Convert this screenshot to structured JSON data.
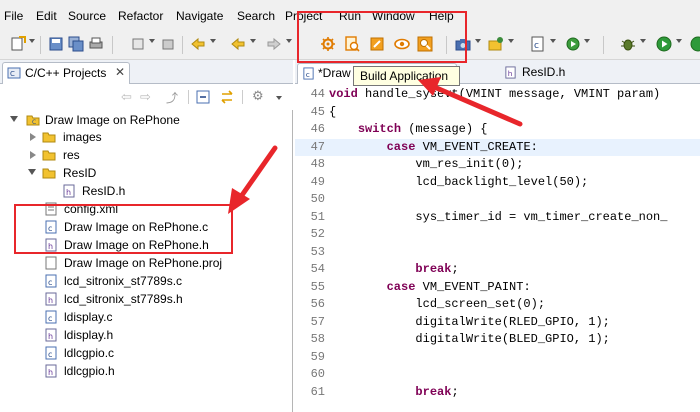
{
  "menu": [
    "File",
    "Edit",
    "Source",
    "Refactor",
    "Navigate",
    "Search",
    "Project",
    "Run",
    "Window",
    "Help"
  ],
  "tooltip": "Build Application",
  "project_panel": {
    "tab_label": "C/C++ Projects",
    "tree": [
      {
        "label": "Draw Image on RePhone",
        "kind": "project",
        "twisty": "open"
      },
      {
        "label": "images",
        "kind": "folder",
        "twisty": "closed"
      },
      {
        "label": "res",
        "kind": "folder",
        "twisty": "closed"
      },
      {
        "label": "ResID",
        "kind": "folder",
        "twisty": "open"
      },
      {
        "label": "ResID.h",
        "kind": "header"
      },
      {
        "label": "config.xml",
        "kind": "xml"
      },
      {
        "label": "Draw Image on RePhone.c",
        "kind": "c-source"
      },
      {
        "label": "Draw Image on RePhone.h",
        "kind": "header"
      },
      {
        "label": "Draw Image on RePhone.proj",
        "kind": "file"
      },
      {
        "label": "lcd_sitronix_st7789s.c",
        "kind": "c-source"
      },
      {
        "label": "lcd_sitronix_st7789s.h",
        "kind": "header"
      },
      {
        "label": "ldisplay.c",
        "kind": "c-source"
      },
      {
        "label": "ldisplay.h",
        "kind": "header"
      },
      {
        "label": "ldlcgpio.c",
        "kind": "c-source"
      },
      {
        "label": "ldlcgpio.h",
        "kind": "header"
      }
    ]
  },
  "editor": {
    "tabs": [
      "*Draw",
      "ResID.h"
    ],
    "lines": [
      {
        "n": "44",
        "text": "void handle_sysevt(VMINT message, VMINT param)"
      },
      {
        "n": "45",
        "text": "{"
      },
      {
        "n": "46",
        "text": "    switch (message) {"
      },
      {
        "n": "47",
        "text": "        case VM_EVENT_CREATE:"
      },
      {
        "n": "48",
        "text": "            vm_res_init(0);"
      },
      {
        "n": "49",
        "text": "            lcd_backlight_level(50);"
      },
      {
        "n": "50",
        "text": ""
      },
      {
        "n": "51",
        "text": "            sys_timer_id = vm_timer_create_non_"
      },
      {
        "n": "52",
        "text": ""
      },
      {
        "n": "53",
        "text": ""
      },
      {
        "n": "54",
        "text": "            break;"
      },
      {
        "n": "55",
        "text": "        case VM_EVENT_PAINT:"
      },
      {
        "n": "56",
        "text": "            lcd_screen_set(0);"
      },
      {
        "n": "57",
        "text": "            digitalWrite(RLED_GPIO, 1);"
      },
      {
        "n": "58",
        "text": "            digitalWrite(BLED_GPIO, 1);"
      },
      {
        "n": "59",
        "text": ""
      },
      {
        "n": "60",
        "text": ""
      },
      {
        "n": "61",
        "text": "            break;"
      }
    ]
  },
  "colors": {
    "annotation_red": "#e8262b",
    "keyword": "#7f0055",
    "current_line": "#e8f2fe"
  }
}
